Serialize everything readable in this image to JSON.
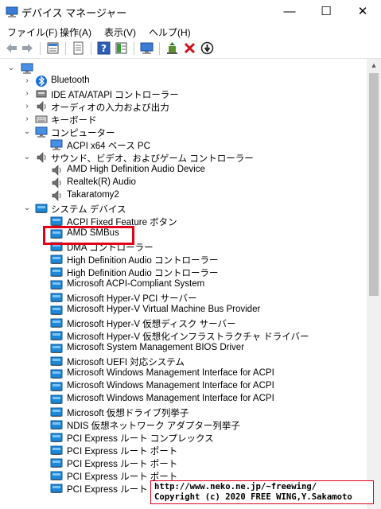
{
  "window": {
    "title": "デバイス マネージャー",
    "minimize_glyph": "—",
    "maximize_glyph": "☐",
    "close_glyph": "✕"
  },
  "menu": [
    "ファイル(F)",
    "操作(A)",
    "表示(V)",
    "ヘルプ(H)"
  ],
  "toolbar_icons": [
    "back-arrow-icon",
    "forward-arrow-icon",
    "properties-pane-icon",
    "device-list-icon",
    "help-icon",
    "action-pane-icon",
    "monitor-scan-icon",
    "add-driver-icon",
    "uninstall-device-icon",
    "update-driver-icon"
  ],
  "tree": {
    "root_label": "",
    "items": [
      {
        "level": 1,
        "expand": "›",
        "icon": "bluetooth",
        "label": "Bluetooth"
      },
      {
        "level": 1,
        "expand": "›",
        "icon": "ide",
        "label": "IDE ATA/ATAPI コントローラー"
      },
      {
        "level": 1,
        "expand": "›",
        "icon": "audio",
        "label": "オーディオの入力および出力"
      },
      {
        "level": 1,
        "expand": "›",
        "icon": "keyboard",
        "label": "キーボード"
      },
      {
        "level": 1,
        "expand": "⌄",
        "icon": "computer",
        "label": "コンピューター"
      },
      {
        "level": 2,
        "expand": "",
        "icon": "computer",
        "label": "ACPI x64 ベース PC"
      },
      {
        "level": 1,
        "expand": "⌄",
        "icon": "audio",
        "label": "サウンド、ビデオ、およびゲーム コントローラー"
      },
      {
        "level": 2,
        "expand": "",
        "icon": "audio",
        "label": "AMD High Definition Audio Device"
      },
      {
        "level": 2,
        "expand": "",
        "icon": "audio",
        "label": "Realtek(R) Audio"
      },
      {
        "level": 2,
        "expand": "",
        "icon": "audio",
        "label": "Takaratomy2"
      },
      {
        "level": 1,
        "expand": "⌄",
        "icon": "system",
        "label": "システム デバイス"
      },
      {
        "level": 2,
        "expand": "",
        "icon": "system",
        "label": "ACPI Fixed Feature ボタン"
      },
      {
        "level": 2,
        "expand": "",
        "icon": "system",
        "label": "AMD SMBus"
      },
      {
        "level": 2,
        "expand": "",
        "icon": "system",
        "label": "DMA コントローラー"
      },
      {
        "level": 2,
        "expand": "",
        "icon": "system",
        "label": "High Definition Audio コントローラー"
      },
      {
        "level": 2,
        "expand": "",
        "icon": "system",
        "label": "High Definition Audio コントローラー"
      },
      {
        "level": 2,
        "expand": "",
        "icon": "system",
        "label": "Microsoft ACPI-Compliant System"
      },
      {
        "level": 2,
        "expand": "",
        "icon": "system",
        "label": "Microsoft Hyper-V PCI サーバー"
      },
      {
        "level": 2,
        "expand": "",
        "icon": "system",
        "label": "Microsoft Hyper-V Virtual Machine Bus Provider"
      },
      {
        "level": 2,
        "expand": "",
        "icon": "system",
        "label": "Microsoft Hyper-V 仮想ディスク サーバー"
      },
      {
        "level": 2,
        "expand": "",
        "icon": "system",
        "label": "Microsoft Hyper-V 仮想化インフラストラクチャ ドライバー"
      },
      {
        "level": 2,
        "expand": "",
        "icon": "system",
        "label": "Microsoft System Management BIOS Driver"
      },
      {
        "level": 2,
        "expand": "",
        "icon": "system",
        "label": "Microsoft UEFI 対応システム"
      },
      {
        "level": 2,
        "expand": "",
        "icon": "system",
        "label": "Microsoft Windows Management Interface for ACPI"
      },
      {
        "level": 2,
        "expand": "",
        "icon": "system",
        "label": "Microsoft Windows Management Interface for ACPI"
      },
      {
        "level": 2,
        "expand": "",
        "icon": "system",
        "label": "Microsoft Windows Management Interface for ACPI"
      },
      {
        "level": 2,
        "expand": "",
        "icon": "system",
        "label": "Microsoft 仮想ドライブ列挙子"
      },
      {
        "level": 2,
        "expand": "",
        "icon": "system",
        "label": "NDIS 仮想ネットワーク アダプター列挙子"
      },
      {
        "level": 2,
        "expand": "",
        "icon": "system",
        "label": "PCI Express ルート コンプレックス"
      },
      {
        "level": 2,
        "expand": "",
        "icon": "system",
        "label": "PCI Express ルート ポート"
      },
      {
        "level": 2,
        "expand": "",
        "icon": "system",
        "label": "PCI Express ルート ポート"
      },
      {
        "level": 2,
        "expand": "",
        "icon": "system",
        "label": "PCI Express ルート ポート"
      },
      {
        "level": 2,
        "expand": "",
        "icon": "system",
        "label": "PCI Express ルート ポート"
      }
    ]
  },
  "overlay": {
    "line1": "http://www.neko.ne.jp/~freewing/",
    "line2": "Copyright (c) 2020 FREE WING,Y.Sakamoto"
  },
  "colors": {
    "highlight": "#e0001a",
    "folder_blue": "#1e88d8",
    "delete_red": "#d0121b"
  }
}
